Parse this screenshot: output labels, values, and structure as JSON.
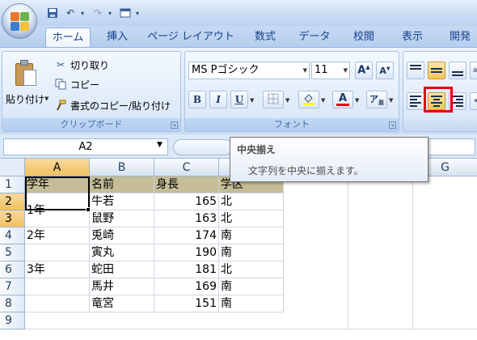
{
  "quick_access": {
    "icons": [
      "save-icon",
      "undo-icon",
      "redo-icon",
      "customize-icon"
    ]
  },
  "tabs": [
    {
      "label": "ホーム",
      "active": true
    },
    {
      "label": "挿入"
    },
    {
      "label": "ページ レイアウト"
    },
    {
      "label": "数式"
    },
    {
      "label": "データ"
    },
    {
      "label": "校閲"
    },
    {
      "label": "表示"
    },
    {
      "label": "開発"
    }
  ],
  "clipboard": {
    "paste_label": "貼り付け",
    "cut_label": "切り取り",
    "copy_label": "コピー",
    "format_painter_label": "書式のコピー/貼り付け",
    "group_label": "クリップボード"
  },
  "font": {
    "font_name": "MS Pゴシック",
    "font_size": "11",
    "bold": "B",
    "italic": "I",
    "underline": "U",
    "font_color_glyph": "A",
    "group_label": "フォント",
    "colors": {
      "fill": "#ffff00",
      "font": "#e60012"
    }
  },
  "alignment": {
    "highlighted": [
      "middle-align",
      "center-align"
    ],
    "center_button_outline_color": "#e60012"
  },
  "formula_bar": {
    "name_box": "A2"
  },
  "tooltip": {
    "title": "中央揃え",
    "body": "文字列を中央に揃えます。"
  },
  "sheet": {
    "columns": [
      "A",
      "B",
      "C",
      "D",
      "E",
      "F",
      "G"
    ],
    "rows": [
      "1",
      "2",
      "3",
      "4",
      "5",
      "6",
      "7",
      "8",
      "9"
    ],
    "header_row_color": "#c4bd97",
    "header_cells": [
      "学年",
      "名前",
      "身長",
      "学区"
    ],
    "merged_a2": "1年",
    "data": [
      {
        "grade": "",
        "name": "牛若",
        "height": "165",
        "district": "北"
      },
      {
        "grade": "",
        "name": "鼠野",
        "height": "163",
        "district": "北"
      },
      {
        "grade": "2年",
        "name": "兎崎",
        "height": "174",
        "district": "南"
      },
      {
        "grade": "",
        "name": "寅丸",
        "height": "190",
        "district": "南"
      },
      {
        "grade": "3年",
        "name": "蛇田",
        "height": "181",
        "district": "北"
      },
      {
        "grade": "",
        "name": "馬井",
        "height": "169",
        "district": "南"
      },
      {
        "grade": "",
        "name": "竜宮",
        "height": "151",
        "district": "南"
      }
    ]
  }
}
